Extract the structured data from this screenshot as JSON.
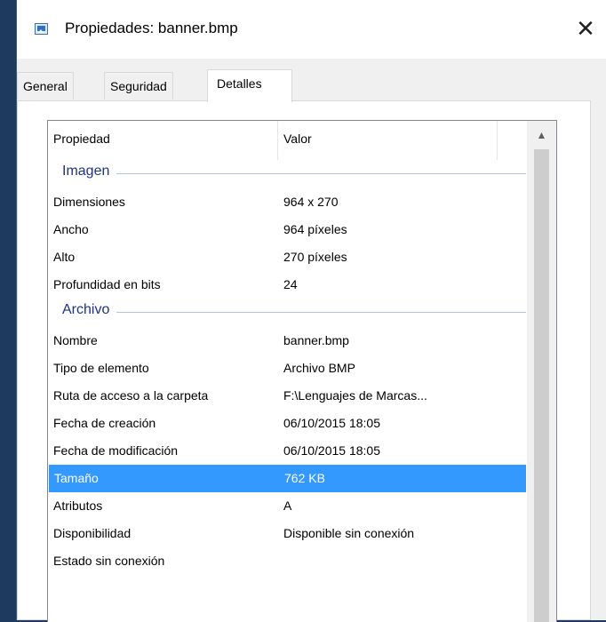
{
  "window": {
    "title": "Propiedades: banner.bmp",
    "close_label": "✕"
  },
  "tabs": [
    {
      "label": "General",
      "active": false
    },
    {
      "label": "Seguridad",
      "active": false
    },
    {
      "label": "Detalles",
      "active": true
    }
  ],
  "details": {
    "headers": {
      "property": "Propiedad",
      "value": "Valor"
    },
    "groups": [
      {
        "title": "Imagen",
        "rows": [
          {
            "property": "Dimensiones",
            "value": "964 x 270"
          },
          {
            "property": "Ancho",
            "value": "964 píxeles"
          },
          {
            "property": "Alto",
            "value": "270 píxeles"
          },
          {
            "property": "Profundidad en bits",
            "value": "24"
          }
        ]
      },
      {
        "title": "Archivo",
        "rows": [
          {
            "property": "Nombre",
            "value": "banner.bmp"
          },
          {
            "property": "Tipo de elemento",
            "value": "Archivo BMP"
          },
          {
            "property": "Ruta de acceso a la carpeta",
            "value": "F:\\Lenguajes de Marcas..."
          },
          {
            "property": "Fecha de creación",
            "value": "06/10/2015 18:05"
          },
          {
            "property": "Fecha de modificación",
            "value": "06/10/2015 18:05"
          },
          {
            "property": "Tamaño",
            "value": "762 KB",
            "selected": true
          },
          {
            "property": "Atributos",
            "value": "A"
          },
          {
            "property": "Disponibilidad",
            "value": "Disponible sin conexión"
          },
          {
            "property": "Estado sin conexión",
            "value": ""
          }
        ]
      }
    ]
  },
  "icons": {
    "title_icon": "image-file-icon",
    "scroll_up": "scroll-up-arrow-icon"
  },
  "colors": {
    "selection": "#3399ff",
    "group_title": "#1e3287"
  }
}
